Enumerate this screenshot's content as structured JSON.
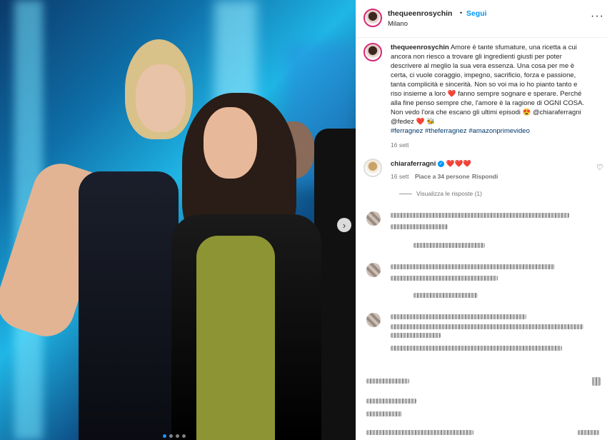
{
  "post": {
    "username": "thequeenrosychin",
    "follow_label": "Segui",
    "separator": "•",
    "location": "Milano",
    "caption_user": "thequeenrosychin",
    "caption_lines": [
      "Amore è tante sfumature, una ricetta a cui",
      "ancora non riesco a trovare gli ingredienti giusti per poter",
      "descrivere al meglio la sua vera essenza. Una cosa per me è",
      "certa, ci vuole coraggio, impegno, sacrificio, forza e passione,",
      "tanta complicità e sincerità. Non so voi ma io ho pianto tanto e",
      "riso insieme a loro ❤️ fanno sempre sognare e sperare. Perché",
      "alla fine penso sempre che, l'amore è la ragione di OGNI COSA.",
      "Non vedo l'ora che escano gli ultimi episodi 😍 @chiaraferragni",
      "@fedez ❤️ 🐝"
    ],
    "hashtags": "#ferragnez #theferragnez #amazonprimevideo",
    "caption_time": "16 sett"
  },
  "comment": {
    "username": "chiaraferragni",
    "verified_icon": "verified-badge-icon",
    "text": "❤️❤️❤️",
    "time": "16 sett",
    "likes": "Piace a 34 persone",
    "reply_label": "Rispondi",
    "view_replies": "Visualizza le risposte (1)"
  },
  "colors": {
    "link": "#0095f6",
    "hashtag": "#00376b",
    "muted": "#737373"
  }
}
